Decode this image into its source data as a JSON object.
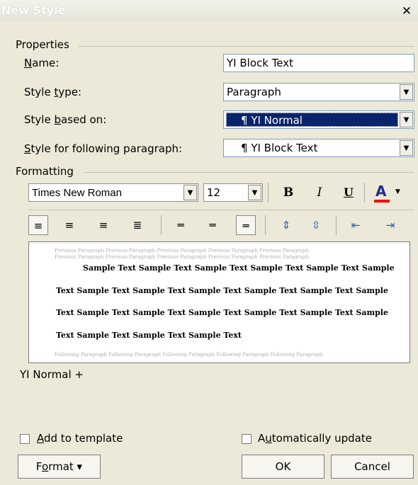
{
  "window": {
    "title": "New Style",
    "close_glyph": "✕"
  },
  "properties": {
    "group_label": "Properties",
    "name_label": "Name:",
    "name_value": "YI Block Text",
    "style_type_label": "Style type:",
    "style_type_value": "Paragraph",
    "based_on_label": "Style based on:",
    "based_on_value": "YI Normal",
    "following_label": "Style for following paragraph:",
    "following_value": "YI Block Text"
  },
  "formatting": {
    "group_label": "Formatting",
    "font_value": "Times New Roman",
    "size_value": "12",
    "bold": "B",
    "italic": "I",
    "underline": "U",
    "font_color": "A",
    "font_color_swatch": "#ff0000"
  },
  "preview": {
    "previous_paragraph": "Previous Paragraph Previous Paragraph Previous Paragraph Previous Paragraph Previous Paragraph",
    "previous_paragraph_2": "Previous Paragraph Previous Paragraph Previous Paragraph Previous Paragraph Previous Paragraph",
    "sample_line_1": "Sample Text Sample Text Sample Text Sample Text Sample Text Sample",
    "sample_line_2": "Text Sample Text Sample Text Sample Text Sample Text Sample Text Sample",
    "sample_line_3": "Text Sample Text Sample Text Sample Text Sample Text Sample Text Sample",
    "sample_line_4": "Text Sample Text Sample Text Sample Text",
    "following_paragraph": "Following Paragraph Following Paragraph Following Paragraph Following Paragraph Following Paragraph"
  },
  "description": "YI Normal +",
  "options": {
    "add_to_template": "Add to template",
    "automatically_update": "Automatically update"
  },
  "buttons": {
    "format": "Format",
    "ok": "OK",
    "cancel": "Cancel"
  }
}
